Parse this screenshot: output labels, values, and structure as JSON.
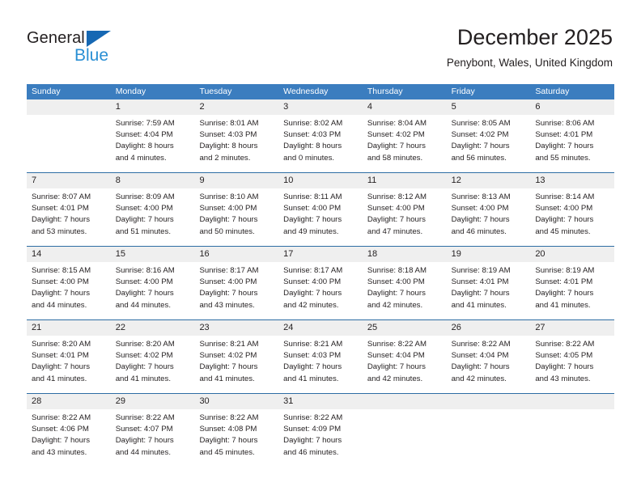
{
  "brand": {
    "word1": "General",
    "word2": "Blue",
    "triangle_color": "#1668b3",
    "word2_color": "#2a8fd4"
  },
  "header": {
    "title": "December 2025",
    "subtitle": "Penybont, Wales, United Kingdom"
  },
  "colors": {
    "header_row": "#3b7dbf",
    "number_band": "#efefef",
    "week_divider": "#2e6da4",
    "text": "#231f20"
  },
  "day_names": [
    "Sunday",
    "Monday",
    "Tuesday",
    "Wednesday",
    "Thursday",
    "Friday",
    "Saturday"
  ],
  "weeks": [
    {
      "numbers": [
        "",
        "1",
        "2",
        "3",
        "4",
        "5",
        "6"
      ],
      "cells": [
        {
          "l1": "",
          "l2": "",
          "l3": "",
          "l4": ""
        },
        {
          "l1": "Sunrise: 7:59 AM",
          "l2": "Sunset: 4:04 PM",
          "l3": "Daylight: 8 hours",
          "l4": "and 4 minutes."
        },
        {
          "l1": "Sunrise: 8:01 AM",
          "l2": "Sunset: 4:03 PM",
          "l3": "Daylight: 8 hours",
          "l4": "and 2 minutes."
        },
        {
          "l1": "Sunrise: 8:02 AM",
          "l2": "Sunset: 4:03 PM",
          "l3": "Daylight: 8 hours",
          "l4": "and 0 minutes."
        },
        {
          "l1": "Sunrise: 8:04 AM",
          "l2": "Sunset: 4:02 PM",
          "l3": "Daylight: 7 hours",
          "l4": "and 58 minutes."
        },
        {
          "l1": "Sunrise: 8:05 AM",
          "l2": "Sunset: 4:02 PM",
          "l3": "Daylight: 7 hours",
          "l4": "and 56 minutes."
        },
        {
          "l1": "Sunrise: 8:06 AM",
          "l2": "Sunset: 4:01 PM",
          "l3": "Daylight: 7 hours",
          "l4": "and 55 minutes."
        }
      ]
    },
    {
      "numbers": [
        "7",
        "8",
        "9",
        "10",
        "11",
        "12",
        "13"
      ],
      "cells": [
        {
          "l1": "Sunrise: 8:07 AM",
          "l2": "Sunset: 4:01 PM",
          "l3": "Daylight: 7 hours",
          "l4": "and 53 minutes."
        },
        {
          "l1": "Sunrise: 8:09 AM",
          "l2": "Sunset: 4:00 PM",
          "l3": "Daylight: 7 hours",
          "l4": "and 51 minutes."
        },
        {
          "l1": "Sunrise: 8:10 AM",
          "l2": "Sunset: 4:00 PM",
          "l3": "Daylight: 7 hours",
          "l4": "and 50 minutes."
        },
        {
          "l1": "Sunrise: 8:11 AM",
          "l2": "Sunset: 4:00 PM",
          "l3": "Daylight: 7 hours",
          "l4": "and 49 minutes."
        },
        {
          "l1": "Sunrise: 8:12 AM",
          "l2": "Sunset: 4:00 PM",
          "l3": "Daylight: 7 hours",
          "l4": "and 47 minutes."
        },
        {
          "l1": "Sunrise: 8:13 AM",
          "l2": "Sunset: 4:00 PM",
          "l3": "Daylight: 7 hours",
          "l4": "and 46 minutes."
        },
        {
          "l1": "Sunrise: 8:14 AM",
          "l2": "Sunset: 4:00 PM",
          "l3": "Daylight: 7 hours",
          "l4": "and 45 minutes."
        }
      ]
    },
    {
      "numbers": [
        "14",
        "15",
        "16",
        "17",
        "18",
        "19",
        "20"
      ],
      "cells": [
        {
          "l1": "Sunrise: 8:15 AM",
          "l2": "Sunset: 4:00 PM",
          "l3": "Daylight: 7 hours",
          "l4": "and 44 minutes."
        },
        {
          "l1": "Sunrise: 8:16 AM",
          "l2": "Sunset: 4:00 PM",
          "l3": "Daylight: 7 hours",
          "l4": "and 44 minutes."
        },
        {
          "l1": "Sunrise: 8:17 AM",
          "l2": "Sunset: 4:00 PM",
          "l3": "Daylight: 7 hours",
          "l4": "and 43 minutes."
        },
        {
          "l1": "Sunrise: 8:17 AM",
          "l2": "Sunset: 4:00 PM",
          "l3": "Daylight: 7 hours",
          "l4": "and 42 minutes."
        },
        {
          "l1": "Sunrise: 8:18 AM",
          "l2": "Sunset: 4:00 PM",
          "l3": "Daylight: 7 hours",
          "l4": "and 42 minutes."
        },
        {
          "l1": "Sunrise: 8:19 AM",
          "l2": "Sunset: 4:01 PM",
          "l3": "Daylight: 7 hours",
          "l4": "and 41 minutes."
        },
        {
          "l1": "Sunrise: 8:19 AM",
          "l2": "Sunset: 4:01 PM",
          "l3": "Daylight: 7 hours",
          "l4": "and 41 minutes."
        }
      ]
    },
    {
      "numbers": [
        "21",
        "22",
        "23",
        "24",
        "25",
        "26",
        "27"
      ],
      "cells": [
        {
          "l1": "Sunrise: 8:20 AM",
          "l2": "Sunset: 4:01 PM",
          "l3": "Daylight: 7 hours",
          "l4": "and 41 minutes."
        },
        {
          "l1": "Sunrise: 8:20 AM",
          "l2": "Sunset: 4:02 PM",
          "l3": "Daylight: 7 hours",
          "l4": "and 41 minutes."
        },
        {
          "l1": "Sunrise: 8:21 AM",
          "l2": "Sunset: 4:02 PM",
          "l3": "Daylight: 7 hours",
          "l4": "and 41 minutes."
        },
        {
          "l1": "Sunrise: 8:21 AM",
          "l2": "Sunset: 4:03 PM",
          "l3": "Daylight: 7 hours",
          "l4": "and 41 minutes."
        },
        {
          "l1": "Sunrise: 8:22 AM",
          "l2": "Sunset: 4:04 PM",
          "l3": "Daylight: 7 hours",
          "l4": "and 42 minutes."
        },
        {
          "l1": "Sunrise: 8:22 AM",
          "l2": "Sunset: 4:04 PM",
          "l3": "Daylight: 7 hours",
          "l4": "and 42 minutes."
        },
        {
          "l1": "Sunrise: 8:22 AM",
          "l2": "Sunset: 4:05 PM",
          "l3": "Daylight: 7 hours",
          "l4": "and 43 minutes."
        }
      ]
    },
    {
      "numbers": [
        "28",
        "29",
        "30",
        "31",
        "",
        "",
        ""
      ],
      "cells": [
        {
          "l1": "Sunrise: 8:22 AM",
          "l2": "Sunset: 4:06 PM",
          "l3": "Daylight: 7 hours",
          "l4": "and 43 minutes."
        },
        {
          "l1": "Sunrise: 8:22 AM",
          "l2": "Sunset: 4:07 PM",
          "l3": "Daylight: 7 hours",
          "l4": "and 44 minutes."
        },
        {
          "l1": "Sunrise: 8:22 AM",
          "l2": "Sunset: 4:08 PM",
          "l3": "Daylight: 7 hours",
          "l4": "and 45 minutes."
        },
        {
          "l1": "Sunrise: 8:22 AM",
          "l2": "Sunset: 4:09 PM",
          "l3": "Daylight: 7 hours",
          "l4": "and 46 minutes."
        },
        {
          "l1": "",
          "l2": "",
          "l3": "",
          "l4": ""
        },
        {
          "l1": "",
          "l2": "",
          "l3": "",
          "l4": ""
        },
        {
          "l1": "",
          "l2": "",
          "l3": "",
          "l4": ""
        }
      ]
    }
  ]
}
